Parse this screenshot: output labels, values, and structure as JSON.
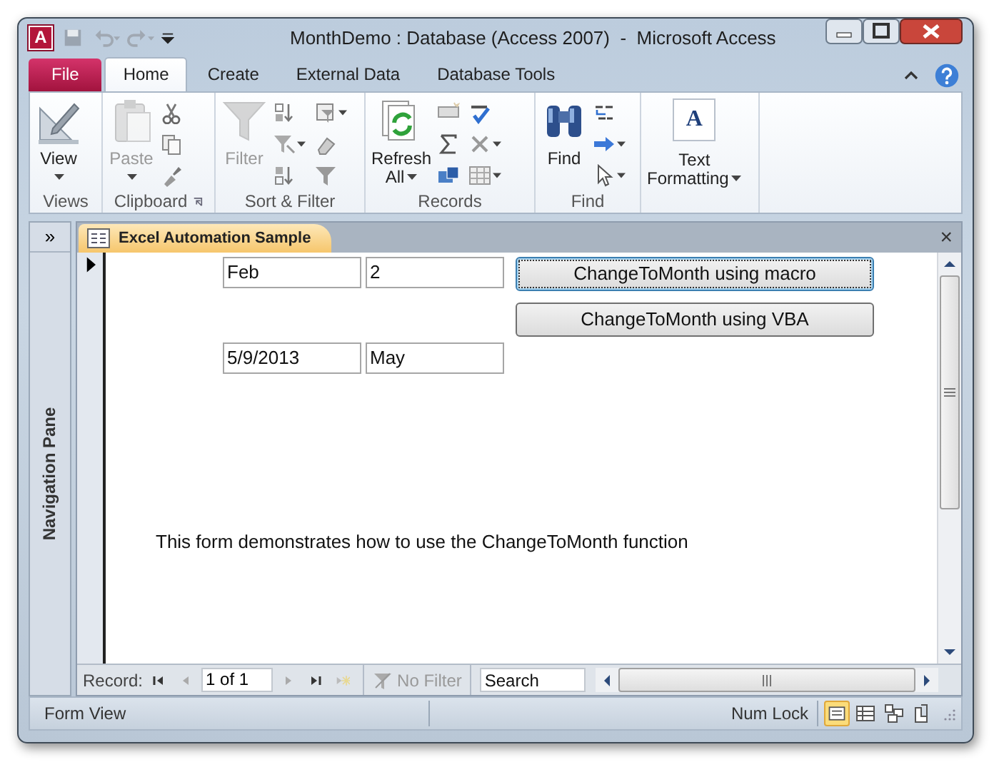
{
  "window": {
    "title": "MonthDemo : Database (Access 2007)  -  Microsoft Access",
    "logo": "A"
  },
  "ribbon_tabs": [
    {
      "label": "File",
      "kind": "file",
      "selected": false
    },
    {
      "label": "Home",
      "kind": "tab",
      "selected": true
    },
    {
      "label": "Create",
      "kind": "tab",
      "selected": false
    },
    {
      "label": "External Data",
      "kind": "tab",
      "selected": false
    },
    {
      "label": "Database Tools",
      "kind": "tab",
      "selected": false
    }
  ],
  "ribbon_groups": [
    {
      "label": "Views",
      "launcher": false,
      "buttons": [
        {
          "lines": [
            "View"
          ],
          "caret": true,
          "disabled": false
        }
      ]
    },
    {
      "label": "Clipboard",
      "launcher": true,
      "buttons": [
        {
          "lines": [
            "Paste"
          ],
          "caret": true,
          "disabled": true
        }
      ]
    },
    {
      "label": "Sort & Filter",
      "launcher": false,
      "buttons": [
        {
          "lines": [
            "Filter"
          ],
          "caret": false,
          "disabled": true
        }
      ]
    },
    {
      "label": "Records",
      "launcher": false,
      "buttons": [
        {
          "lines": [
            "Refresh",
            "All"
          ],
          "caret": true,
          "disabled": false
        }
      ]
    },
    {
      "label": "Find",
      "launcher": false,
      "buttons": [
        {
          "lines": [
            "Find"
          ],
          "caret": false,
          "disabled": false
        }
      ]
    },
    {
      "launcher": false,
      "buttons": [
        {
          "lines": [
            "Text",
            "Formatting"
          ],
          "caret": true,
          "disabled": false,
          "glyph": "A"
        }
      ]
    }
  ],
  "navigation_pane": {
    "toggle": "»",
    "title": "Navigation Pane"
  },
  "document_tab": {
    "title": "Excel Automation Sample",
    "close": "×"
  },
  "form": {
    "rows": [
      {
        "fields": [
          "Feb",
          "2"
        ],
        "button": {
          "label": "ChangeToMonth using macro",
          "focused": true
        }
      },
      {
        "button": {
          "label": "ChangeToMonth using VBA",
          "focused": false
        }
      },
      {
        "fields": [
          "5/9/2013",
          "May"
        ]
      }
    ],
    "note": "This form demonstrates how to use the ChangeToMonth function"
  },
  "record_navigator": {
    "label": "Record:",
    "position": "1 of 1",
    "filter": "No Filter",
    "search": {
      "placeholder": "Search"
    }
  },
  "status_bar": {
    "view": "Form View",
    "indicator": "Num Lock",
    "views": [
      {
        "selected": true
      },
      {
        "selected": false
      },
      {
        "selected": false
      },
      {
        "selected": false
      }
    ]
  }
}
